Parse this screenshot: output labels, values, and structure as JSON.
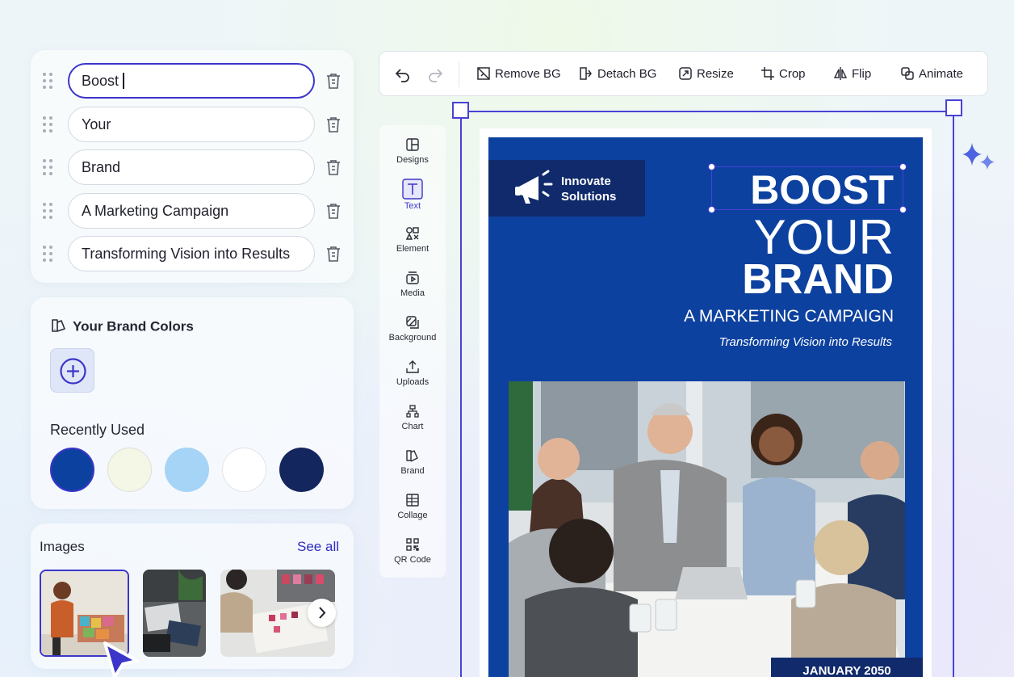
{
  "text_fields": [
    {
      "value": "Boost",
      "active": true
    },
    {
      "value": "Your"
    },
    {
      "value": "Brand"
    },
    {
      "value": "A Marketing Campaign"
    },
    {
      "value": "Transforming Vision into Results"
    }
  ],
  "brand_colors": {
    "title": "Your Brand Colors",
    "recent_label": "Recently Used",
    "recent": [
      "#0d419f",
      "#f4f6e6",
      "#a6d4f7",
      "#ffffff",
      "#14265e"
    ]
  },
  "images": {
    "title": "Images",
    "see_all": "See all"
  },
  "toolbar": {
    "remove_bg": "Remove BG",
    "detach_bg": "Detach BG",
    "resize": "Resize",
    "crop": "Crop",
    "flip": "Flip",
    "animate": "Animate"
  },
  "tools": [
    {
      "label": "Designs",
      "icon": "layout-icon"
    },
    {
      "label": "Text",
      "icon": "text-icon",
      "active": true
    },
    {
      "label": "Element",
      "icon": "shapes-icon"
    },
    {
      "label": "Media",
      "icon": "media-icon"
    },
    {
      "label": "Background",
      "icon": "background-icon"
    },
    {
      "label": "Uploads",
      "icon": "upload-icon"
    },
    {
      "label": "Chart",
      "icon": "chart-icon"
    },
    {
      "label": "Brand",
      "icon": "brand-icon"
    },
    {
      "label": "Collage",
      "icon": "collage-icon"
    },
    {
      "label": "QR Code",
      "icon": "qr-code-icon"
    }
  ],
  "poster": {
    "logo_line1": "Innovate",
    "logo_line2": "Solutions",
    "headline1": "BOOST",
    "headline2": "YOUR",
    "headline3": "BRAND",
    "subtitle": "A MARKETING CAMPAIGN",
    "tagline": "Transforming Vision into Results",
    "date": "JANUARY 2050"
  },
  "colors": {
    "accent": "#3b36c9",
    "poster_blue": "#0d419f",
    "poster_navy": "#102a6b"
  }
}
